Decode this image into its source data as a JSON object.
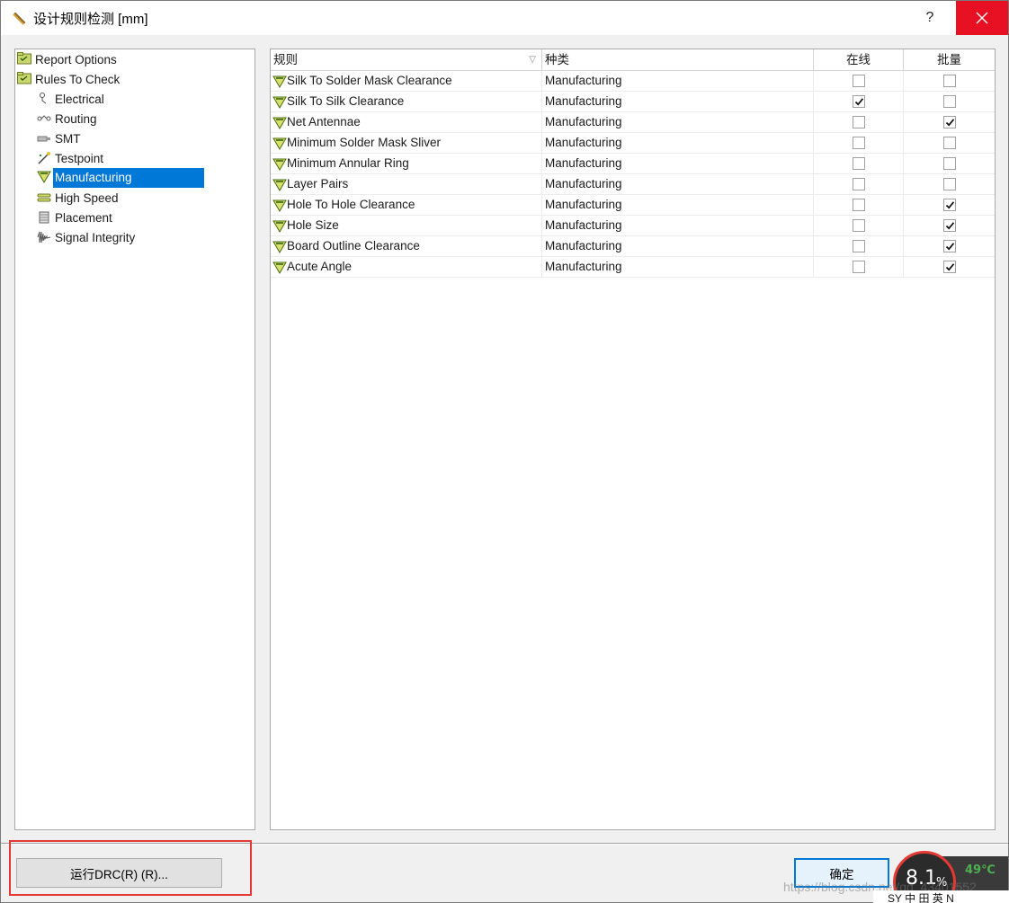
{
  "window": {
    "title": "设计规则检测 [mm]",
    "help_label": "?",
    "close_label": "✕"
  },
  "tree": {
    "items": [
      {
        "label": "Report Options",
        "icon": "folder-icon",
        "level": 0
      },
      {
        "label": "Rules To Check",
        "icon": "folder-icon",
        "level": 0
      },
      {
        "label": "Electrical",
        "icon": "electrical-icon",
        "level": 1
      },
      {
        "label": "Routing",
        "icon": "routing-icon",
        "level": 1
      },
      {
        "label": "SMT",
        "icon": "smt-icon",
        "level": 1
      },
      {
        "label": "Testpoint",
        "icon": "testpoint-icon",
        "level": 1
      },
      {
        "label": "Manufacturing",
        "icon": "manufacturing-icon",
        "level": 1,
        "selected": true
      },
      {
        "label": "High Speed",
        "icon": "high-speed-icon",
        "level": 1
      },
      {
        "label": "Placement",
        "icon": "placement-icon",
        "level": 1
      },
      {
        "label": "Signal Integrity",
        "icon": "signal-integrity-icon",
        "level": 1
      }
    ]
  },
  "grid": {
    "columns": {
      "rule": "规则",
      "kind": "种类",
      "online": "在线",
      "batch": "批量"
    },
    "rows": [
      {
        "rule": "Silk To Solder Mask Clearance",
        "kind": "Manufacturing",
        "online": false,
        "batch": false
      },
      {
        "rule": "Silk To Silk Clearance",
        "kind": "Manufacturing",
        "online": true,
        "batch": false
      },
      {
        "rule": "Net Antennae",
        "kind": "Manufacturing",
        "online": false,
        "batch": true
      },
      {
        "rule": "Minimum Solder Mask Sliver",
        "kind": "Manufacturing",
        "online": false,
        "batch": false
      },
      {
        "rule": "Minimum Annular Ring",
        "kind": "Manufacturing",
        "online": false,
        "batch": false
      },
      {
        "rule": "Layer Pairs",
        "kind": "Manufacturing",
        "online": false,
        "batch": false
      },
      {
        "rule": "Hole To Hole Clearance",
        "kind": "Manufacturing",
        "online": false,
        "batch": true
      },
      {
        "rule": "Hole Size",
        "kind": "Manufacturing",
        "online": false,
        "batch": true
      },
      {
        "rule": "Board Outline Clearance",
        "kind": "Manufacturing",
        "online": false,
        "batch": true
      },
      {
        "rule": "Acute Angle",
        "kind": "Manufacturing",
        "online": false,
        "batch": true
      }
    ]
  },
  "buttons": {
    "run_drc": "运行DRC(R) (R)...",
    "ok": "确定"
  },
  "overlay": {
    "cpu_value": "8.1",
    "cpu_unit": "%",
    "temperature": "49℃",
    "watermark": "https://blog.csdn.net/qq_43401552",
    "taskbar_text": "SY 中 田 英 N"
  },
  "colors": {
    "selection": "#0078d7",
    "close_button": "#e81123",
    "highlight_box": "#e53935"
  }
}
